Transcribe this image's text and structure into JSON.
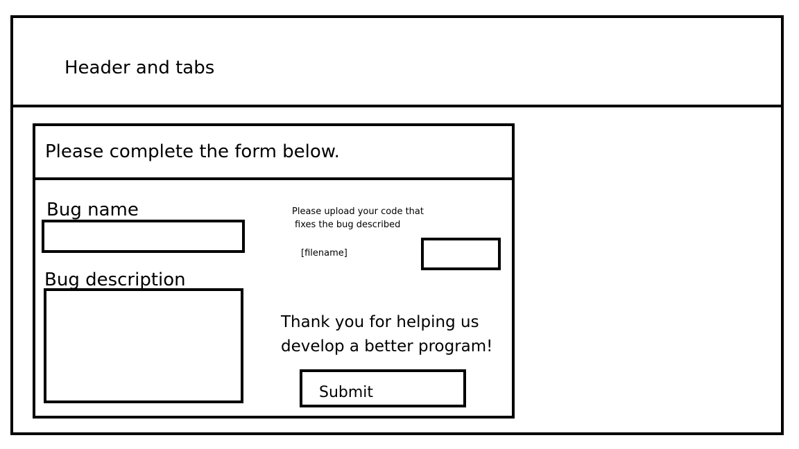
{
  "header": {
    "text": "Header and tabs"
  },
  "form": {
    "title": "Please complete the form below.",
    "bug_name_label": "Bug name",
    "bug_name_value": "",
    "bug_description_label": "Bug description",
    "bug_description_value": "",
    "upload_text_line1": "Please upload your code that",
    "upload_text_line2": "fixes the bug described",
    "filename": "[filename]",
    "thanks_line1": "Thank you for helping us",
    "thanks_line2": "develop a better program!",
    "submit_label": "Submit"
  }
}
